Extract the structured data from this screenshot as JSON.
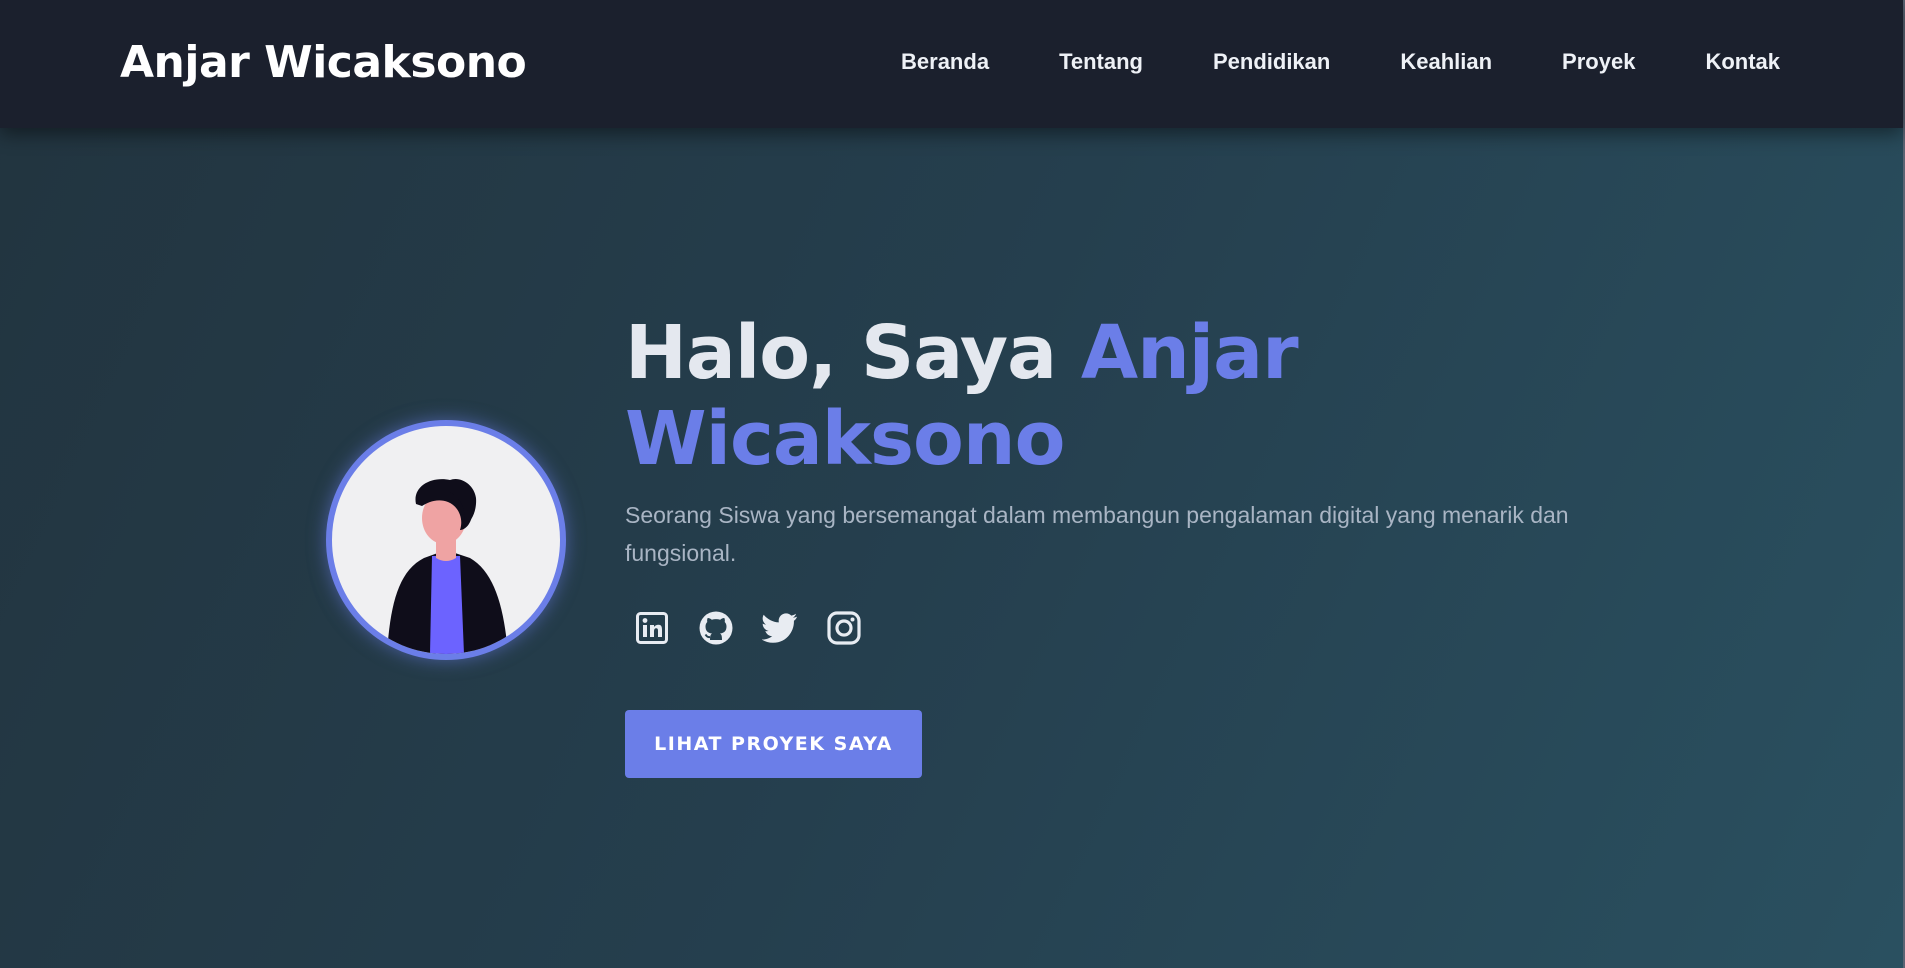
{
  "header": {
    "brand": "Anjar Wicaksono",
    "nav": [
      "Beranda",
      "Tentang",
      "Pendidikan",
      "Keahlian",
      "Proyek",
      "Kontak"
    ]
  },
  "hero": {
    "greeting": "Halo, Saya ",
    "name": "Anjar Wicaksono",
    "tagline": "Seorang Siswa yang bersemangat dalam membangun pengalaman digital yang menarik dan fungsional.",
    "cta_label": "LIHAT PROYEK SAYA",
    "socials": [
      "linkedin-icon",
      "github-icon",
      "twitter-icon",
      "instagram-icon"
    ]
  },
  "colors": {
    "accent": "#6b7ee8",
    "header_bg": "#1b202d",
    "heading_text": "#e4e8ef",
    "body_text": "#a9b5c4"
  }
}
